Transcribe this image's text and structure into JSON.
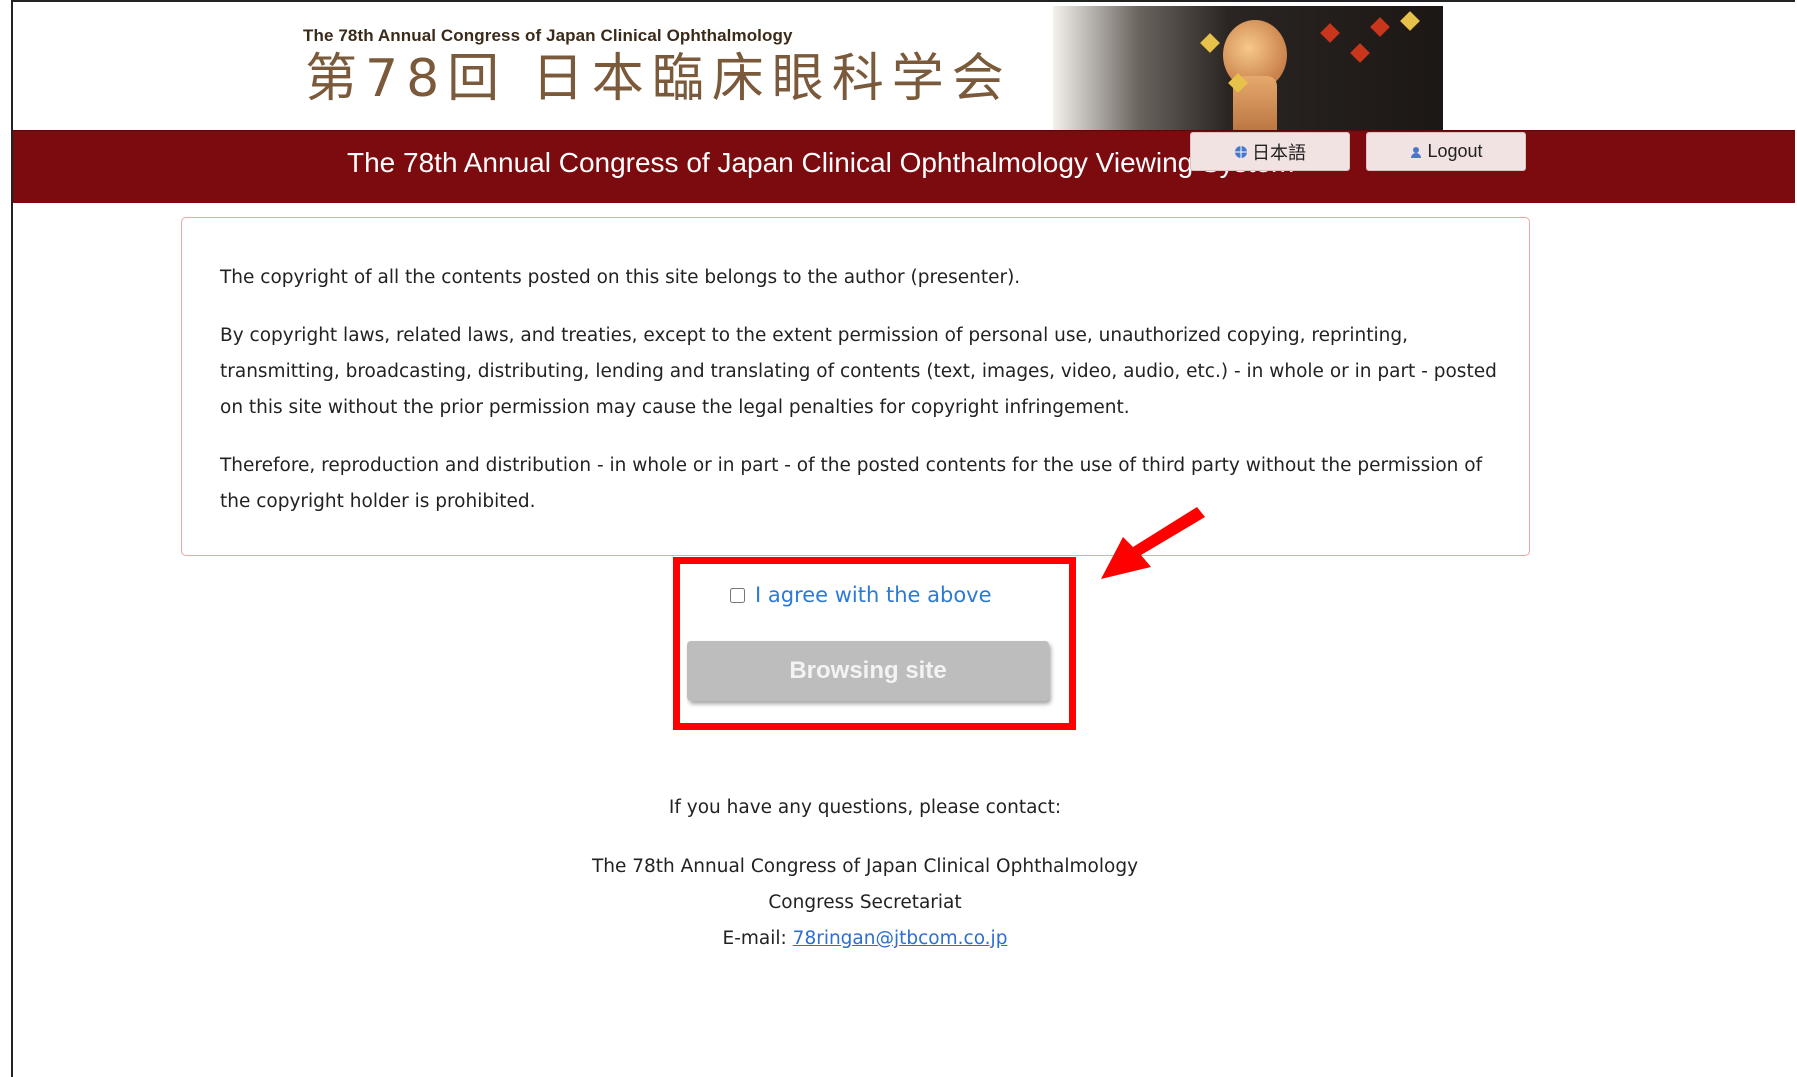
{
  "header": {
    "logo_en": "The 78th Annual Congress of Japan Clinical Ophthalmology",
    "logo_ja": "第78回 日本臨床眼科学会"
  },
  "titlebar": {
    "title": "The 78th Annual Congress of Japan Clinical Ophthalmology Viewing System",
    "language_button": "日本語",
    "logout_button": "Logout"
  },
  "notice": {
    "p1": "The copyright of all the contents posted on this site belongs to the author (presenter).",
    "p2": "By copyright laws, related laws, and treaties, except to the extent permission of personal use, unauthorized copying, reprinting, transmitting, broadcasting, distributing, lending and translating of contents (text, images, video, audio, etc.) - in whole or in part - posted on this site without the prior permission may cause the legal penalties for copyright infringement.",
    "p3": "Therefore, reproduction and distribution - in whole or in part - of the posted contents for the use of third party without the permission of the copyright holder is prohibited."
  },
  "agree": {
    "label": "I agree with the above",
    "checked": false,
    "button": "Browsing site"
  },
  "contact": {
    "intro": "If you have any questions, please contact:",
    "org": "The 78th Annual Congress of Japan Clinical Ophthalmology",
    "dept": "Congress Secretariat",
    "email_prefix": "E-mail: ",
    "email": "78ringan@jtbcom.co.jp"
  },
  "colors": {
    "titlebar": "#7b0b0f",
    "highlight": "#ff0000",
    "link": "#2b7ad8",
    "button_disabled": "#bdbdbd"
  }
}
